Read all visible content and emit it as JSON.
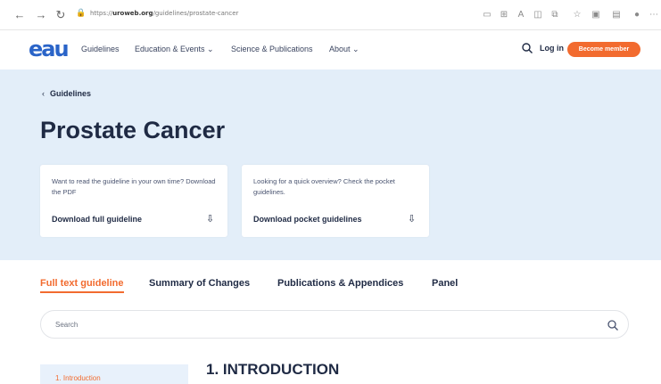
{
  "browser": {
    "back": "←",
    "forward": "→",
    "reload": "↻",
    "url_prefix": "https://",
    "url_domain": "uroweb.org",
    "url_path": "/guidelines/prostate-cancer",
    "toolbar_icons": [
      "reader-view-icon",
      "grid-icon",
      "read-aloud-icon",
      "split-screen-icon",
      "extensions-icon",
      "favorites-icon",
      "collections-icon",
      "profile-icon",
      "avatar-icon",
      "more-icon"
    ]
  },
  "header": {
    "logo": "eau",
    "nav": [
      "Guidelines",
      "Education & Events ⌄",
      "Science & Publications",
      "About ⌄"
    ],
    "login": "Log in",
    "cta": "Become member",
    "accent": "#f26b2f",
    "brand": "#2a64c8"
  },
  "hero": {
    "breadcrumb": "Guidelines",
    "title": "Prostate Cancer",
    "background": "#e3eef9",
    "cards": [
      {
        "text": "Want to read the guideline in your own time? Download the PDF",
        "link": "Download full guideline"
      },
      {
        "text": "Looking for a quick overview? Check the pocket guidelines.",
        "link": "Download pocket guidelines"
      }
    ]
  },
  "tabs": [
    {
      "label": "Full text guideline",
      "active": true
    },
    {
      "label": "Summary of Changes",
      "active": false
    },
    {
      "label": "Publications & Appendices",
      "active": false
    },
    {
      "label": "Panel",
      "active": false
    }
  ],
  "search": {
    "placeholder": "Search"
  },
  "toc": {
    "first_item": "1.  Introduction"
  },
  "content": {
    "heading": "1. INTRODUCTION"
  }
}
